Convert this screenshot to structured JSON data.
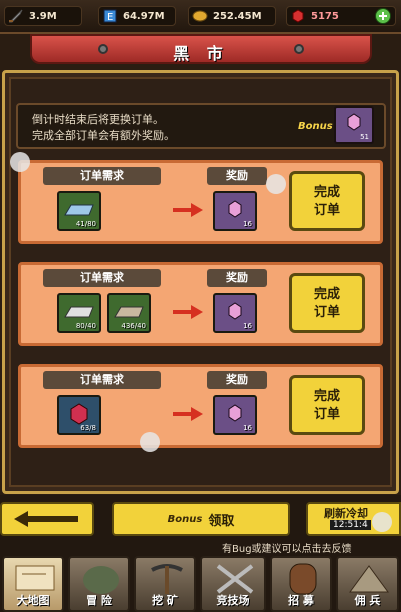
{
  "resources": [
    {
      "icon": "sword-icon",
      "value": "3.9M"
    },
    {
      "icon": "energy-icon",
      "value": "64.97M"
    },
    {
      "icon": "coin-icon",
      "value": "252.45M"
    },
    {
      "icon": "ruby-icon",
      "value": "5175"
    }
  ],
  "title": "黑 市",
  "info": {
    "line1": "倒计时结束后将更换订单。",
    "line2": "完成全部订单会有额外奖励。",
    "bonus_label": "Bonus",
    "bonus_count": "51"
  },
  "orders": [
    {
      "need_label": "订单需求",
      "reward_label": "奖励",
      "items": [
        {
          "count": "41/80"
        }
      ],
      "reward_count": "16",
      "button": "完成\n订单"
    },
    {
      "need_label": "订单需求",
      "reward_label": "奖励",
      "items": [
        {
          "count": "80/40"
        },
        {
          "count": "436/40"
        }
      ],
      "reward_count": "16",
      "button": "完成\n订单"
    },
    {
      "need_label": "订单需求",
      "reward_label": "奖励",
      "items": [
        {
          "count": "63/8"
        }
      ],
      "reward_count": "16",
      "button": "完成\n订单"
    }
  ],
  "bottom": {
    "claim_bonus": "Bonus",
    "claim_label": "领取",
    "refresh_label": "刷新冷却",
    "refresh_time": "12:51:4",
    "tip": "有Bug或建议可以点击去反馈"
  },
  "nav": [
    "大地图",
    "冒 险",
    "挖 矿",
    "竞技场",
    "招 募",
    "佣 兵"
  ],
  "colors": {
    "accent_yellow": "#f2d23a",
    "card_orange": "#f4a673",
    "title_red": "#c0392b"
  }
}
